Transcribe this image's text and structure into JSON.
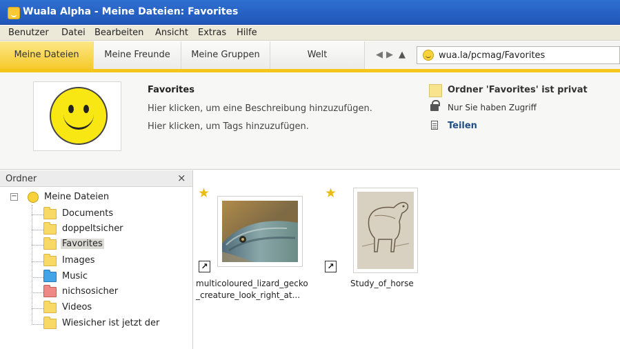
{
  "window": {
    "title": "Wuala Alpha - Meine Dateien: Favorites"
  },
  "menu": [
    "Benutzer",
    "Datei",
    "Bearbeiten",
    "Ansicht",
    "Extras",
    "Hilfe"
  ],
  "tabs": [
    "Meine Dateien",
    "Meine Freunde",
    "Meine Gruppen",
    "Welt"
  ],
  "nav": {
    "back_icon": "back-arrow-icon",
    "forward_icon": "forward-arrow-icon",
    "up_icon": "up-arrow-icon"
  },
  "address": {
    "value": "wua.la/pcmag/Favorites"
  },
  "info": {
    "title": "Favorites",
    "description_link": "Hier klicken, um eine Beschreibung hinzuzufügen.",
    "tags_link": "Hier klicken, um Tags hinzuzufügen.",
    "privacy": "Ordner 'Favorites' ist privat",
    "access": "Nur Sie haben Zugriff",
    "share": "Teilen"
  },
  "sidebar": {
    "title": "Ordner",
    "close": "×",
    "root": "Meine Dateien",
    "folders": [
      {
        "label": "Documents",
        "color": "#f8d965"
      },
      {
        "label": "doppeltsicher",
        "color": "#f8d965"
      },
      {
        "label": "Favorites",
        "color": "#f8d965",
        "selected": true
      },
      {
        "label": "Images",
        "color": "#f8d965"
      },
      {
        "label": "Music",
        "color": "#43a4e8"
      },
      {
        "label": "nichsosicher",
        "color": "#ee8a86"
      },
      {
        "label": "Videos",
        "color": "#f8d965"
      },
      {
        "label": "Wiesicher ist jetzt der",
        "color": "#f8d965"
      }
    ]
  },
  "files": [
    {
      "name_line1": "multicoloured_lizard_gecko",
      "name_line2": "_creature_look_right_at...",
      "starred": true
    },
    {
      "name_line1": "Study_of_horse",
      "name_line2": "",
      "starred": true
    }
  ],
  "colors": {
    "accent": "#f5c61a",
    "titlebar": "#2f6fd0",
    "link": "#1f4f86"
  }
}
